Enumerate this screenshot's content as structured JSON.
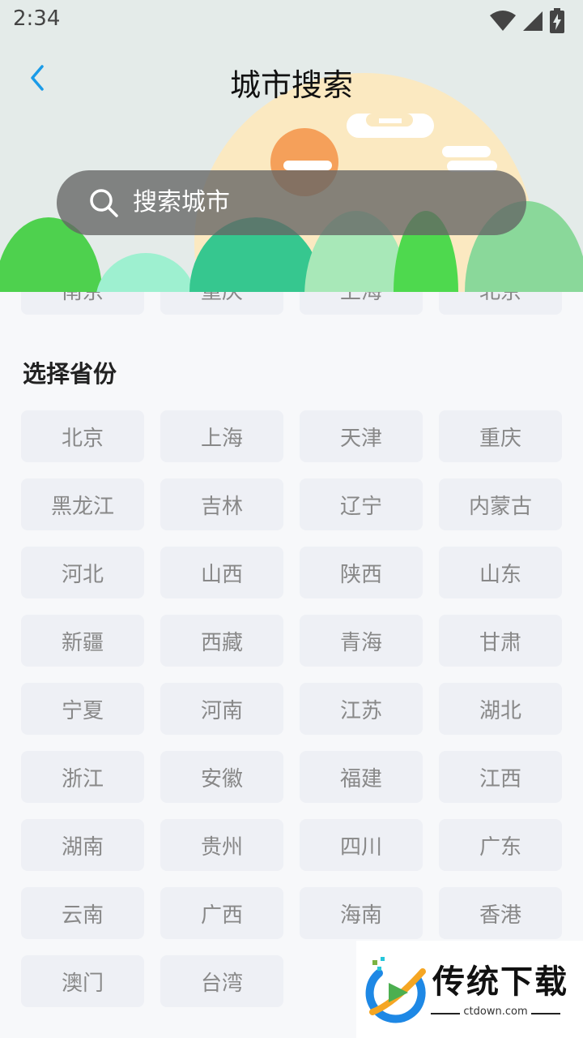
{
  "status_bar": {
    "time": "2:34"
  },
  "header": {
    "title": "城市搜索"
  },
  "search": {
    "placeholder": "搜索城市"
  },
  "hot_cities": [
    "南京",
    "重庆",
    "上海",
    "北京"
  ],
  "province_section": {
    "title": "选择省份",
    "provinces": [
      "北京",
      "上海",
      "天津",
      "重庆",
      "黑龙江",
      "吉林",
      "辽宁",
      "内蒙古",
      "河北",
      "山西",
      "陕西",
      "山东",
      "新疆",
      "西藏",
      "青海",
      "甘肃",
      "宁夏",
      "河南",
      "江苏",
      "湖北",
      "浙江",
      "安徽",
      "福建",
      "江西",
      "湖南",
      "贵州",
      "四川",
      "广东",
      "云南",
      "广西",
      "海南",
      "香港",
      "澳门",
      "台湾"
    ]
  },
  "watermark": {
    "text": "传统下载",
    "url": "ctdown.com"
  },
  "colors": {
    "accent": "#1a9be8",
    "button_bg": "#eef0f5",
    "button_text": "#888888"
  }
}
